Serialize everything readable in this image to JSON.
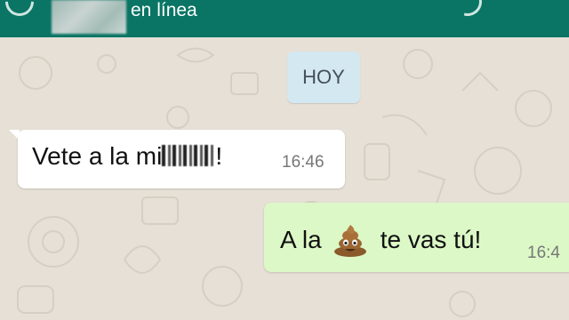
{
  "header": {
    "status": "en línea",
    "bg_color": "#0a7565"
  },
  "chat": {
    "date_chip": "HOY",
    "messages": [
      {
        "direction": "incoming",
        "text_before": "Vete a la mi",
        "text_after": "!",
        "censored": true,
        "time": "16:46"
      },
      {
        "direction": "outgoing",
        "text_before": "A la",
        "emoji": "pile-of-poo-icon",
        "text_after": "te vas tú!",
        "time": "16:4"
      }
    ]
  },
  "colors": {
    "wallpaper": "#e6e0d6",
    "incoming_bubble": "#ffffff",
    "outgoing_bubble": "#dcf8c6",
    "date_chip": "#d4e8f2"
  }
}
